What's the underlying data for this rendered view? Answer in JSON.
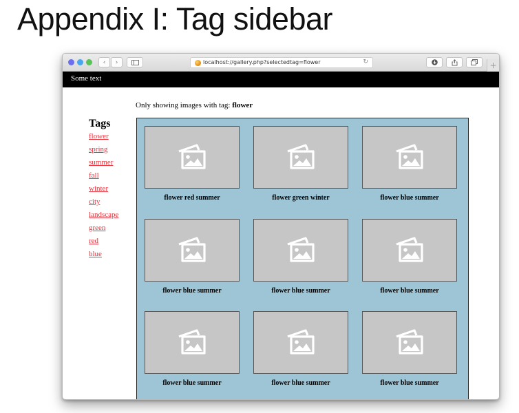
{
  "slide": {
    "title": "Appendix I: Tag sidebar"
  },
  "browser": {
    "url": "localhost://gallery.php?selectedtag=flower",
    "traffic_light_colors": [
      "#ee5f5b",
      "#f5bd4f",
      "#61c454"
    ],
    "icons": {
      "back": "chevron-left-icon",
      "forward": "chevron-right-icon",
      "sidebar": "sidebar-toggle-icon",
      "reload": "reload-icon",
      "downloads": "download-icon",
      "share": "share-icon",
      "tabs": "tabs-overview-icon",
      "new_tab": "plus-icon"
    }
  },
  "page": {
    "header_text": "Some text",
    "filter_prefix": "Only showing images with tag: ",
    "filter_tag": "flower",
    "tags_heading": "Tags",
    "tags": [
      "flower",
      "spring",
      "summer",
      "fall",
      "winter",
      "city",
      "landscape",
      "green",
      "red",
      "blue"
    ],
    "tag_link_color": "#e8333d",
    "gallery_background": "#9dc5d5",
    "gallery": [
      {
        "caption": "flower red summer"
      },
      {
        "caption": "flower green winter"
      },
      {
        "caption": "flower blue summer"
      },
      {
        "caption": "flower blue summer"
      },
      {
        "caption": "flower blue summer"
      },
      {
        "caption": "flower blue summer"
      },
      {
        "caption": "flower blue summer"
      },
      {
        "caption": "flower blue summer"
      },
      {
        "caption": "flower blue summer"
      }
    ]
  }
}
